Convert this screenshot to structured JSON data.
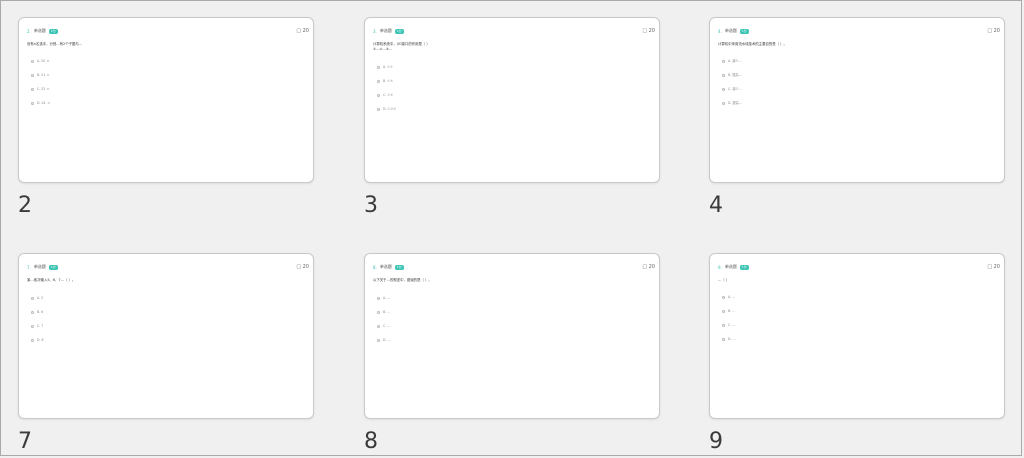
{
  "cards": [
    {
      "number": "2",
      "q_no": "2.",
      "q_type": "单选题",
      "badge": "1分",
      "corner": "□ 20",
      "question": "设有n名选手，分别…有2个子图与…",
      "options": [
        "A. 20  n",
        "B. 21  n",
        "C. 22  n",
        "D. 24  n"
      ]
    },
    {
      "number": "3",
      "q_no": "3.",
      "q_type": "单选题",
      "badge": "1分",
      "corner": "□ 20",
      "question": "计算机系统中，I/O接口的作用是（ ）\n①…②…③…",
      "options": [
        "A. ①②",
        "B. ①③",
        "C. ②③",
        "D. ①②③"
      ]
    },
    {
      "number": "4",
      "q_no": "4.",
      "q_type": "单选题",
      "badge": "1分",
      "corner": "□ 20",
      "question": "计算机中采用流水线技术的主要目的是（ ）。",
      "options": [
        "A. 减少…",
        "B. 提高…",
        "C. 减少…",
        "D. 提高…"
      ]
    },
    {
      "number": "7",
      "q_no": "7.",
      "q_type": "单选题",
      "badge": "1分",
      "corner": "□ 20",
      "question": "某…依次输入5、6、7…（ ）。",
      "options": [
        "A. 5",
        "B. 6",
        "C. 7",
        "D. 8"
      ]
    },
    {
      "number": "8",
      "q_no": "8.",
      "q_type": "单选题",
      "badge": "1分",
      "corner": "□ 20",
      "question": "以下关于…的叙述中，错误的是（ ）。",
      "options": [
        "A. …",
        "B. …",
        "C. …",
        "D. …"
      ]
    },
    {
      "number": "9",
      "q_no": "9.",
      "q_type": "单选题",
      "badge": "1分",
      "corner": "□ 20",
      "question": "…（ ）",
      "options": [
        "A. …",
        "B. …",
        "C. …",
        "D. …"
      ]
    }
  ]
}
